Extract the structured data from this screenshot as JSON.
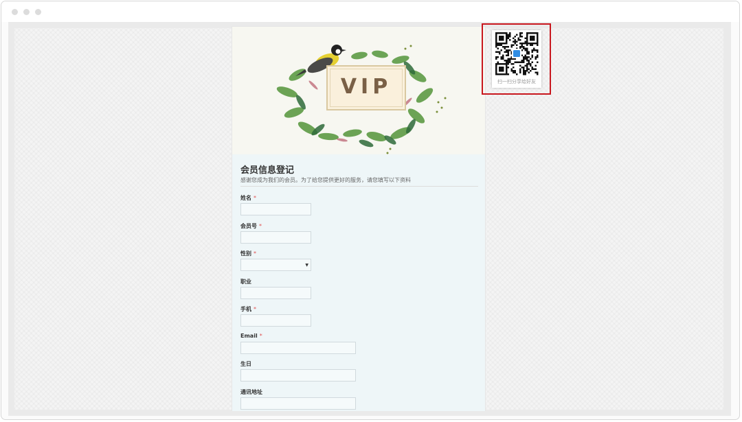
{
  "banner": {
    "badge_text": "VIP"
  },
  "form": {
    "title": "会员信息登记",
    "description": "感谢您成为我们的会员。为了给您提供更好的服务，请您填写以下资料",
    "fields": [
      {
        "label": "姓名",
        "required": "*",
        "type": "text",
        "value": ""
      },
      {
        "label": "会员号",
        "required": "*",
        "type": "text",
        "value": ""
      },
      {
        "label": "性别",
        "required": "*",
        "type": "select",
        "value": ""
      },
      {
        "label": "职业",
        "required": "",
        "type": "text",
        "value": ""
      },
      {
        "label": "手机",
        "required": "*",
        "type": "text",
        "value": ""
      },
      {
        "label": "Email",
        "required": "*",
        "type": "text",
        "value": ""
      },
      {
        "label": "生日",
        "required": "",
        "type": "text",
        "value": ""
      },
      {
        "label": "通讯地址",
        "required": "",
        "type": "text",
        "value": ""
      }
    ]
  },
  "qr_share": {
    "caption": "扫一扫分享给好友",
    "accent_color": "#c8161d"
  },
  "icons": {
    "select_arrow": "dropdown-arrow-icon",
    "qr_center": "qr-center-logo-icon"
  },
  "colors": {
    "required_star": "#e05050",
    "qr_center_logo": "#2f8de4"
  }
}
